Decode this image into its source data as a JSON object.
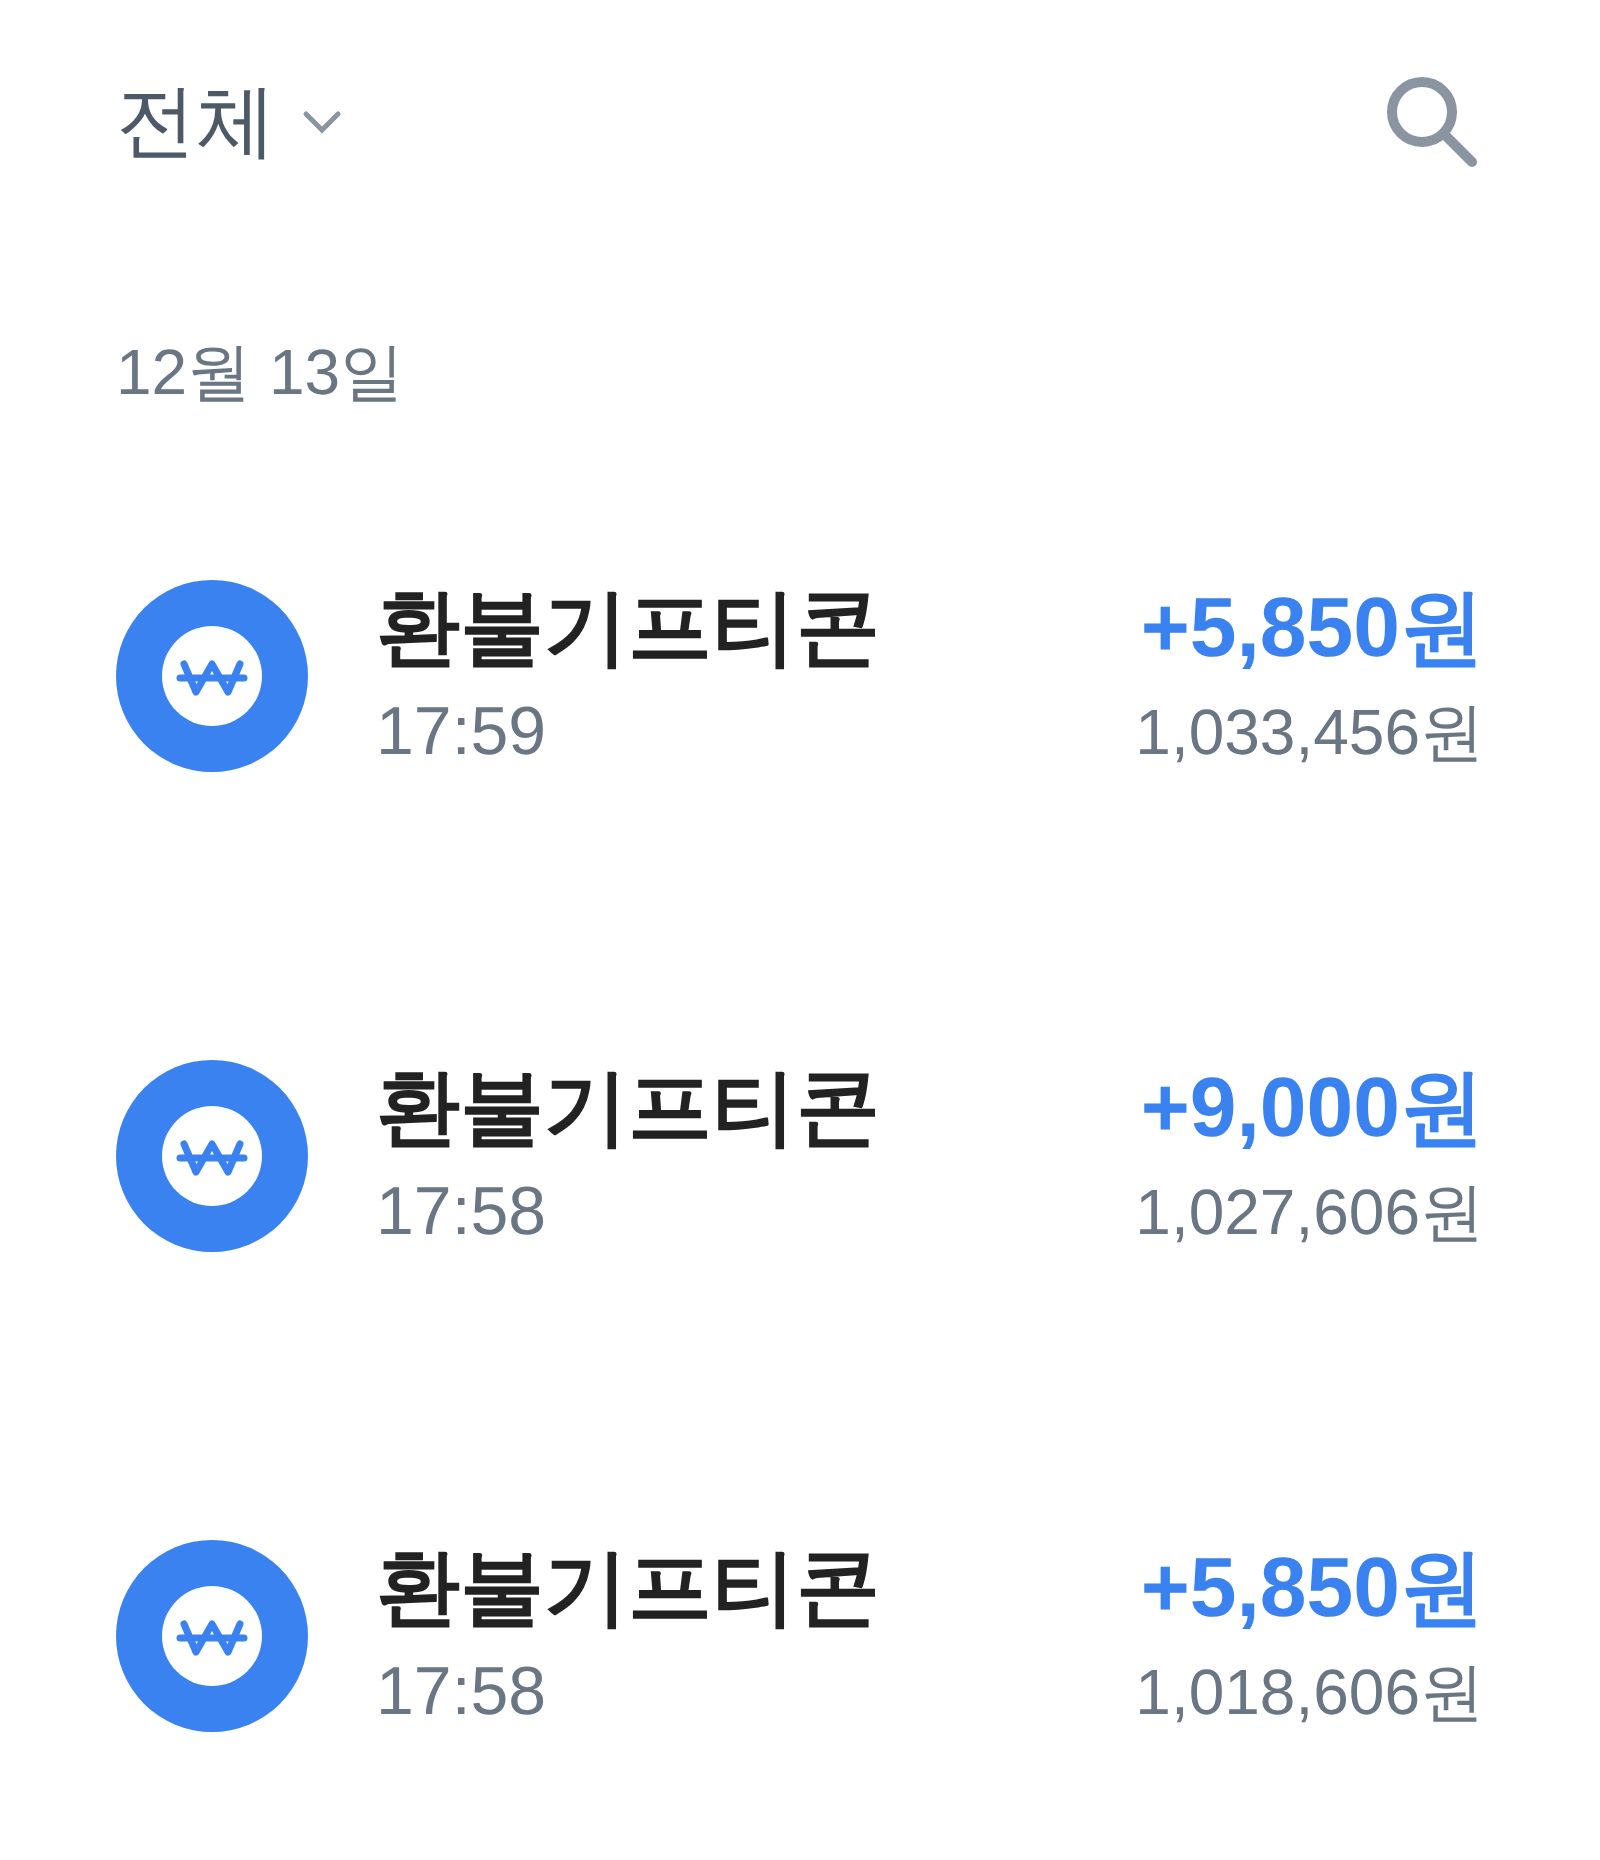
{
  "header": {
    "filter": "전체"
  },
  "date": "12월 13일",
  "transactions": [
    {
      "title": "환불기프티콘",
      "time": "17:59",
      "amount": "+5,850원",
      "balance": "1,033,456원"
    },
    {
      "title": "환불기프티콘",
      "time": "17:58",
      "amount": "+9,000원",
      "balance": "1,027,606원"
    },
    {
      "title": "환불기프티콘",
      "time": "17:58",
      "amount": "+5,850원",
      "balance": "1,018,606원"
    }
  ]
}
